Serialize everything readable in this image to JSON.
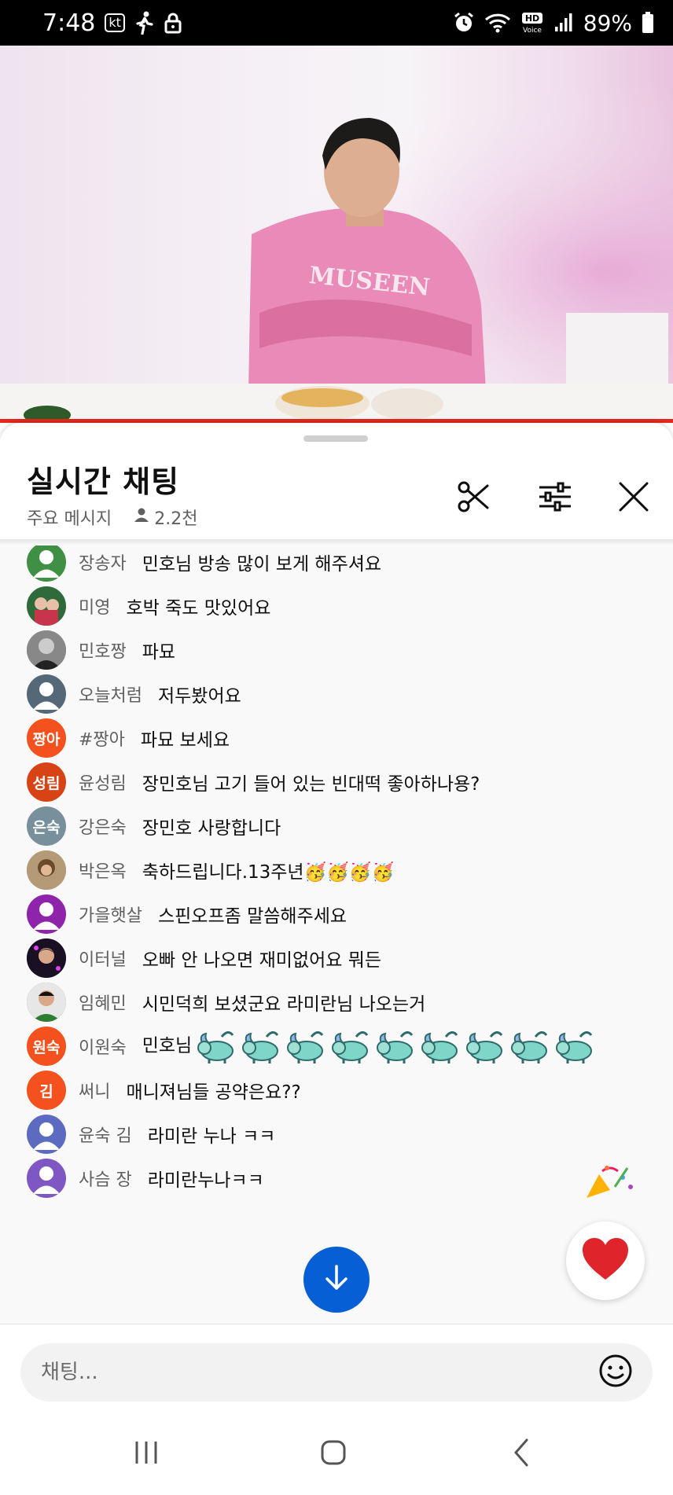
{
  "status_bar": {
    "time": "7:48",
    "carrier": "kt",
    "battery": "89%",
    "icons": [
      "person-walking-icon",
      "lock-icon",
      "alarm-icon",
      "wifi-icon",
      "hd-voice-icon",
      "signal-icon",
      "battery-icon"
    ]
  },
  "video": {
    "progress_color": "#e52a1d"
  },
  "chat": {
    "title": "실시간 채팅",
    "mode": "주요 메시지",
    "viewers": "2.2천",
    "header_icons": [
      "scissors-icon",
      "tune-icon",
      "close-icon"
    ]
  },
  "messages": [
    {
      "author": "장송자",
      "text": "민호님 방송 많이 보게 해주셔요",
      "avatar": "",
      "avatar_color": "#3f8f45"
    },
    {
      "author": "미영",
      "text": "호박 죽도 맛있어요",
      "avatar": "",
      "avatar_color": "#7a9a6a"
    },
    {
      "author": "민호짱",
      "text": "파묘",
      "avatar": "",
      "avatar_color": "#6c6c6c"
    },
    {
      "author": "오늘처럼",
      "text": "저두봤어요",
      "avatar": "",
      "avatar_color": "#546878"
    },
    {
      "author": "#짱아",
      "text": "파묘 보세요",
      "avatar": "짱아",
      "avatar_color": "#f4511e"
    },
    {
      "author": "윤성림",
      "text": "장민호님 고기 들어 있는 빈대떡 좋아하나용?",
      "avatar": "성림",
      "avatar_color": "#d84315"
    },
    {
      "author": "강은숙",
      "text": "장민호 사랑합니다",
      "avatar": "은숙",
      "avatar_color": "#78909c"
    },
    {
      "author": "박은옥",
      "text": "축하드립니다.13주년🥳🥳🥳🥳",
      "avatar": "",
      "avatar_color": "#a08a6a"
    },
    {
      "author": "가을햇살",
      "text": "스핀오프좀 말씀해주세요",
      "avatar": "",
      "avatar_color": "#8e24aa"
    },
    {
      "author": "이터널",
      "text": "오빠 안 나오면 재미없어요 뭐든",
      "avatar": "",
      "avatar_color": "#2a1a3a"
    },
    {
      "author": "임혜민",
      "text": "시민덕희 보셨군요 라미란님 나오는거",
      "avatar": "",
      "avatar_color": "#4e7a4a"
    },
    {
      "author": "이원숙",
      "text": "민호님",
      "avatar": "원숙",
      "avatar_color": "#f4511e",
      "goats": 9
    },
    {
      "author": "써니",
      "text": "매니져님들 공약은요??",
      "avatar": "김",
      "avatar_color": "#f4511e"
    },
    {
      "author": "윤숙 김",
      "text": "라미란 누나 ㅋㅋ",
      "avatar": "",
      "avatar_color": "#5c6bc0"
    },
    {
      "author": "사슴 장",
      "text": "라미란누나ㅋㅋ",
      "avatar": "",
      "avatar_color": "#7e57c2"
    }
  ],
  "input": {
    "placeholder": "채팅...",
    "value": ""
  },
  "floating": {
    "scroll_down_color": "#065fd4",
    "heart_color": "#e0242c"
  },
  "nav": {
    "icons": [
      "recents-icon",
      "home-icon",
      "back-icon"
    ]
  }
}
